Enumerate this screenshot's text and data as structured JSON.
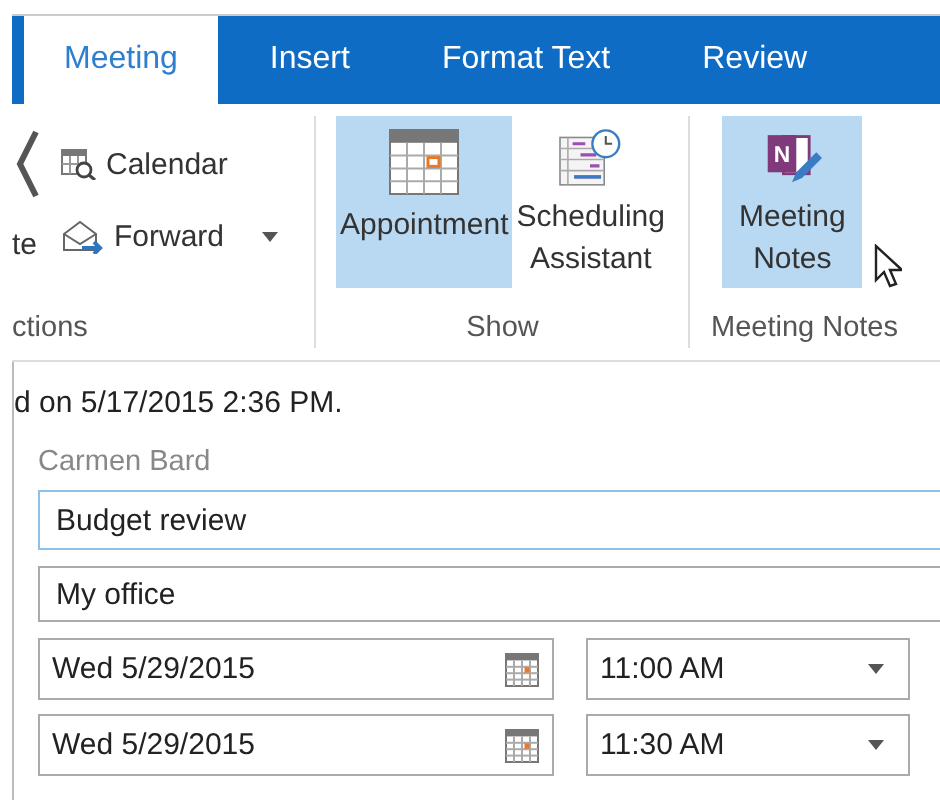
{
  "tabs": [
    {
      "label": "Meeting",
      "selected": true
    },
    {
      "label": "Insert",
      "selected": false
    },
    {
      "label": "Format Text",
      "selected": false
    },
    {
      "label": "Review",
      "selected": false
    }
  ],
  "ribbon": {
    "groups": [
      {
        "label": "ctions",
        "kind": "small",
        "cut_label": "te",
        "items": [
          {
            "label": "Calendar",
            "kind": "calendar",
            "dropdown": false
          },
          {
            "label": "Forward",
            "kind": "forward",
            "dropdown": true
          }
        ]
      },
      {
        "label": "Show",
        "kind": "large",
        "items": [
          {
            "label": "Appointment",
            "kind": "appointment",
            "selected": true
          },
          {
            "label": "Scheduling\nAssistant",
            "kind": "scheduling",
            "selected": false
          }
        ]
      },
      {
        "label": "Meeting Notes",
        "kind": "large",
        "items": [
          {
            "label": "Meeting\nNotes",
            "kind": "onenote",
            "logo_letter": "N",
            "selected": true
          }
        ]
      }
    ]
  },
  "info": "d on 5/17/2015 2:36 PM.",
  "organizer": "Carmen Bard",
  "subject": {
    "value": "Budget review",
    "focused": true
  },
  "location": {
    "value": "My office",
    "focused": false
  },
  "times": [
    {
      "date": "Wed 5/29/2015",
      "time": "11:00 AM"
    },
    {
      "date": "Wed 5/29/2015",
      "time": "11:30 AM"
    }
  ]
}
